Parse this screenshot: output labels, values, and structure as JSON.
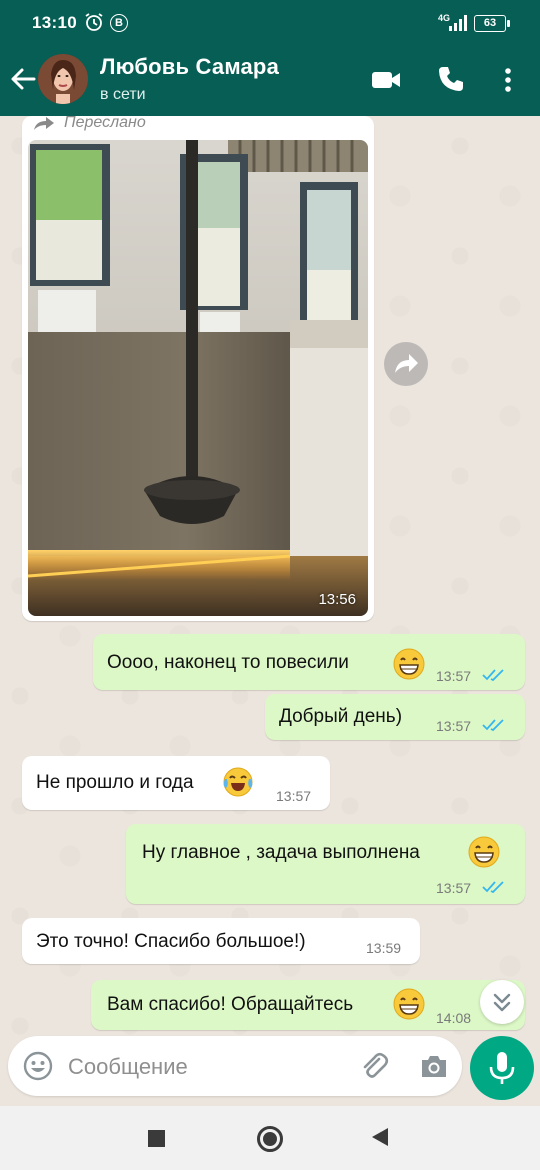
{
  "status_bar": {
    "time": "13:10",
    "b_badge": "B",
    "network": "4G",
    "battery": "63"
  },
  "header": {
    "contact_name": "Любовь Самара",
    "contact_status": "в сети"
  },
  "forwarded_label": "Переслано",
  "image_message": {
    "time": "13:56"
  },
  "messages": [
    {
      "direction": "out",
      "text": "Оооо, наконец то повесили",
      "emoji": "grin",
      "time": "13:57",
      "read": true
    },
    {
      "direction": "out",
      "text": "Добрый день)",
      "time": "13:57",
      "read": true
    },
    {
      "direction": "in",
      "text": "Не прошло и года",
      "emoji": "tears-of-joy",
      "time": "13:57"
    },
    {
      "direction": "out",
      "text": "Ну главное , задача выполнена",
      "emoji": "grin",
      "time": "13:57",
      "read": true
    },
    {
      "direction": "in",
      "text": "Это точно! Спасибо большое!)",
      "time": "13:59"
    },
    {
      "direction": "out",
      "text": "Вам спасибо! Обращайтесь",
      "emoji": "grin",
      "time": "14:08",
      "read": true
    }
  ],
  "composer": {
    "placeholder": "Сообщение"
  },
  "colors": {
    "header": "#075e54",
    "outgoing": "#dcf8c6",
    "incoming": "#ffffff",
    "accent": "#00a884",
    "read_ticks": "#34b7f1"
  }
}
